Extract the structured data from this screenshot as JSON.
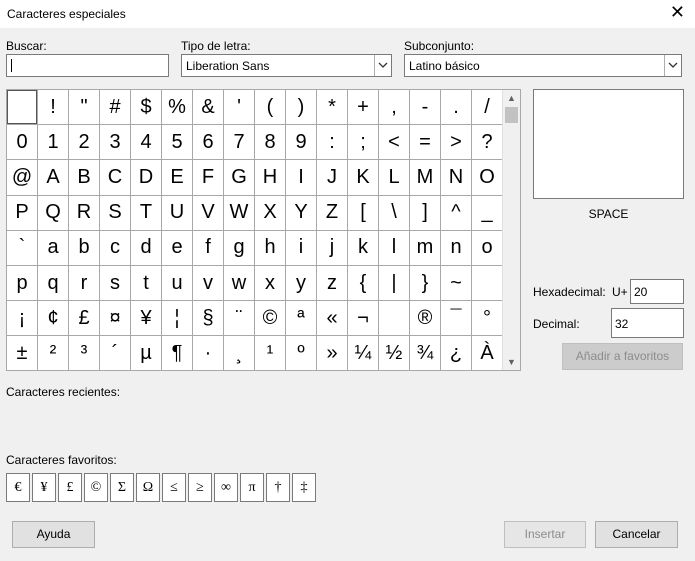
{
  "window": {
    "title": "Caracteres especiales",
    "close_icon": "close-icon"
  },
  "search": {
    "label": "Buscar:",
    "value": ""
  },
  "font": {
    "label": "Tipo de letra:",
    "value": "Liberation Sans"
  },
  "subset": {
    "label": "Subconjunto:",
    "value": "Latino básico"
  },
  "grid": {
    "chars": [
      " ",
      "!",
      "\"",
      "#",
      "$",
      "%",
      "&",
      "'",
      "(",
      ")",
      "*",
      "+",
      ",",
      "-",
      ".",
      "/",
      "0",
      "1",
      "2",
      "3",
      "4",
      "5",
      "6",
      "7",
      "8",
      "9",
      ":",
      ";",
      "<",
      "=",
      ">",
      "?",
      "@",
      "A",
      "B",
      "C",
      "D",
      "E",
      "F",
      "G",
      "H",
      "I",
      "J",
      "K",
      "L",
      "M",
      "N",
      "O",
      "P",
      "Q",
      "R",
      "S",
      "T",
      "U",
      "V",
      "W",
      "X",
      "Y",
      "Z",
      "[",
      "\\",
      "]",
      "^",
      "_",
      "`",
      "a",
      "b",
      "c",
      "d",
      "e",
      "f",
      "g",
      "h",
      "i",
      "j",
      "k",
      "l",
      "m",
      "n",
      "o",
      "p",
      "q",
      "r",
      "s",
      "t",
      "u",
      "v",
      "w",
      "x",
      "y",
      "z",
      "{",
      "|",
      "}",
      "~",
      "",
      "¡",
      "¢",
      "£",
      "¤",
      "¥",
      "¦",
      "§",
      "¨",
      "©",
      "ª",
      "«",
      "¬",
      "",
      "®",
      "¯",
      "°",
      "±",
      "²",
      "³",
      "´",
      "µ",
      "¶",
      "·",
      "¸",
      "¹",
      "º",
      "»",
      "¼",
      "½",
      "¾",
      "¿",
      "À"
    ]
  },
  "preview": {
    "char_name": "SPACE"
  },
  "hex": {
    "label": "Hexadecimal:",
    "prefix": "U+",
    "value": "20"
  },
  "decimal": {
    "label": "Decimal:",
    "value": "32"
  },
  "add_favorites": {
    "label": "Añadir a favoritos"
  },
  "recent": {
    "label": "Caracteres recientes:"
  },
  "favorites": {
    "label": "Caracteres favoritos:",
    "chars": [
      "€",
      "¥",
      "£",
      "©",
      "Σ",
      "Ω",
      "≤",
      "≥",
      "∞",
      "π",
      "†",
      "‡"
    ]
  },
  "buttons": {
    "help": "Ayuda",
    "insert": "Insertar",
    "cancel": "Cancelar"
  }
}
